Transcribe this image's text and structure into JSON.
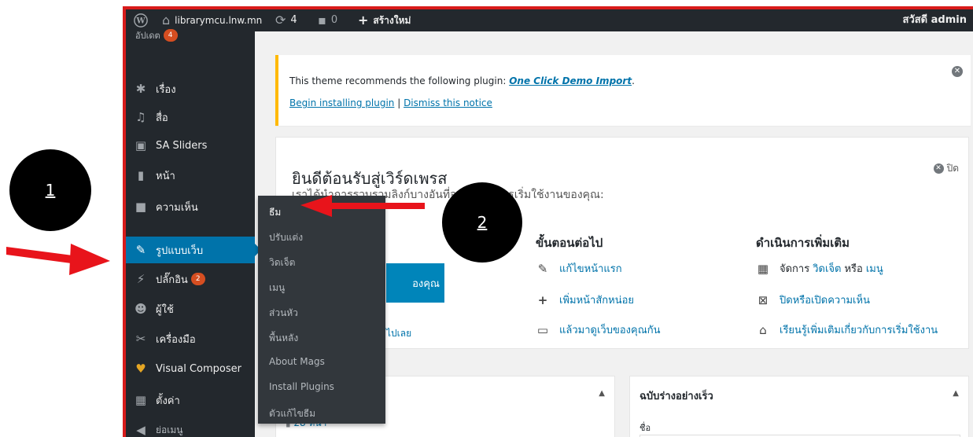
{
  "adminbar": {
    "site_name": "librarymcu.lnw.mn",
    "updates_count": "4",
    "comments_count": "0",
    "new_label": "สร้างใหม่",
    "greeting": "สวัสดี admin"
  },
  "sidebar": {
    "partial_item": {
      "label": "อัปเดต",
      "badge": "4"
    },
    "items": [
      {
        "label": "เรื่อง",
        "icon": "pin-icon"
      },
      {
        "label": "สื่อ",
        "icon": "media-icon"
      },
      {
        "label": "SA Sliders",
        "icon": "slides-icon"
      },
      {
        "label": "หน้า",
        "icon": "page-icon"
      },
      {
        "label": "ความเห็น",
        "icon": "comment-icon"
      },
      {
        "label": "รูปแบบเว็บ",
        "icon": "brush-icon",
        "active": true
      },
      {
        "label": "ปลั๊กอิน",
        "icon": "plugin-icon",
        "badge": "2"
      },
      {
        "label": "ผู้ใช้",
        "icon": "user-icon"
      },
      {
        "label": "เครื่องมือ",
        "icon": "wrench-icon"
      },
      {
        "label": "Visual Composer",
        "icon": "vc-icon"
      },
      {
        "label": "ตั้งค่า",
        "icon": "settings-icon"
      },
      {
        "label": "ย่อเมนู",
        "icon": "collapse-icon"
      }
    ]
  },
  "submenu": [
    "ธีม",
    "ปรับแต่ง",
    "วิดเจ็ต",
    "เมนู",
    "ส่วนหัว",
    "พื้นหลัง",
    "About Mags",
    "Install Plugins",
    "ตัวแก้ไขธีม"
  ],
  "notice": {
    "text": "This theme recommends the following plugin: ",
    "plugin_link": "One Click Demo Import",
    "period": ".",
    "begin_link": "Begin installing plugin",
    "separator": " | ",
    "dismiss_link": "Dismiss this notice"
  },
  "welcome": {
    "title": "ยินดีต้อนรับสู่เวิร์ดเพรส",
    "subtitle": "เราได้นำการรวบรวมลิงก์บางอันที่จะช่วยในการเริ่มใช้งานของคุณ:",
    "close_label": "ปิด",
    "button_partial": "องคุณ",
    "left_link_partial": "ไปเลย",
    "next_steps_heading": "ขั้นตอนต่อไป",
    "next_steps": [
      {
        "icon": "edit-icon",
        "label": "แก้ไขหน้าแรก"
      },
      {
        "icon": "plus-icon",
        "label": "เพิ่มหน้าสักหน่อย"
      },
      {
        "icon": "view-icon",
        "label": "แล้วมาดูเว็บของคุณกัน"
      }
    ],
    "more_heading": "ดำเนินการเพิ่มเติม",
    "more_actions": {
      "manage_prefix": "จัดการ",
      "widgets": "วิดเจ็ต",
      "or": "หรือ",
      "menus": "เมนู",
      "comments": "ปิดหรือเปิดความเห็น",
      "learn": "เรียนรู้เพิ่มเติมเกี่ยวกับการเริ่มใช้งาน"
    }
  },
  "at_a_glance": {
    "partial": "28 หน้า"
  },
  "quick_draft": {
    "title": "ฉบับร่างอย่างเร็ว",
    "field_label": "ชื่อ"
  },
  "annotations": {
    "circle1": "1",
    "circle2": "2",
    "arrow_color": "#e8141b"
  },
  "colors": {
    "accent": "#0073aa",
    "adminbar": "#23282d",
    "notice_border": "#ffb900",
    "badge": "#d54e21"
  }
}
